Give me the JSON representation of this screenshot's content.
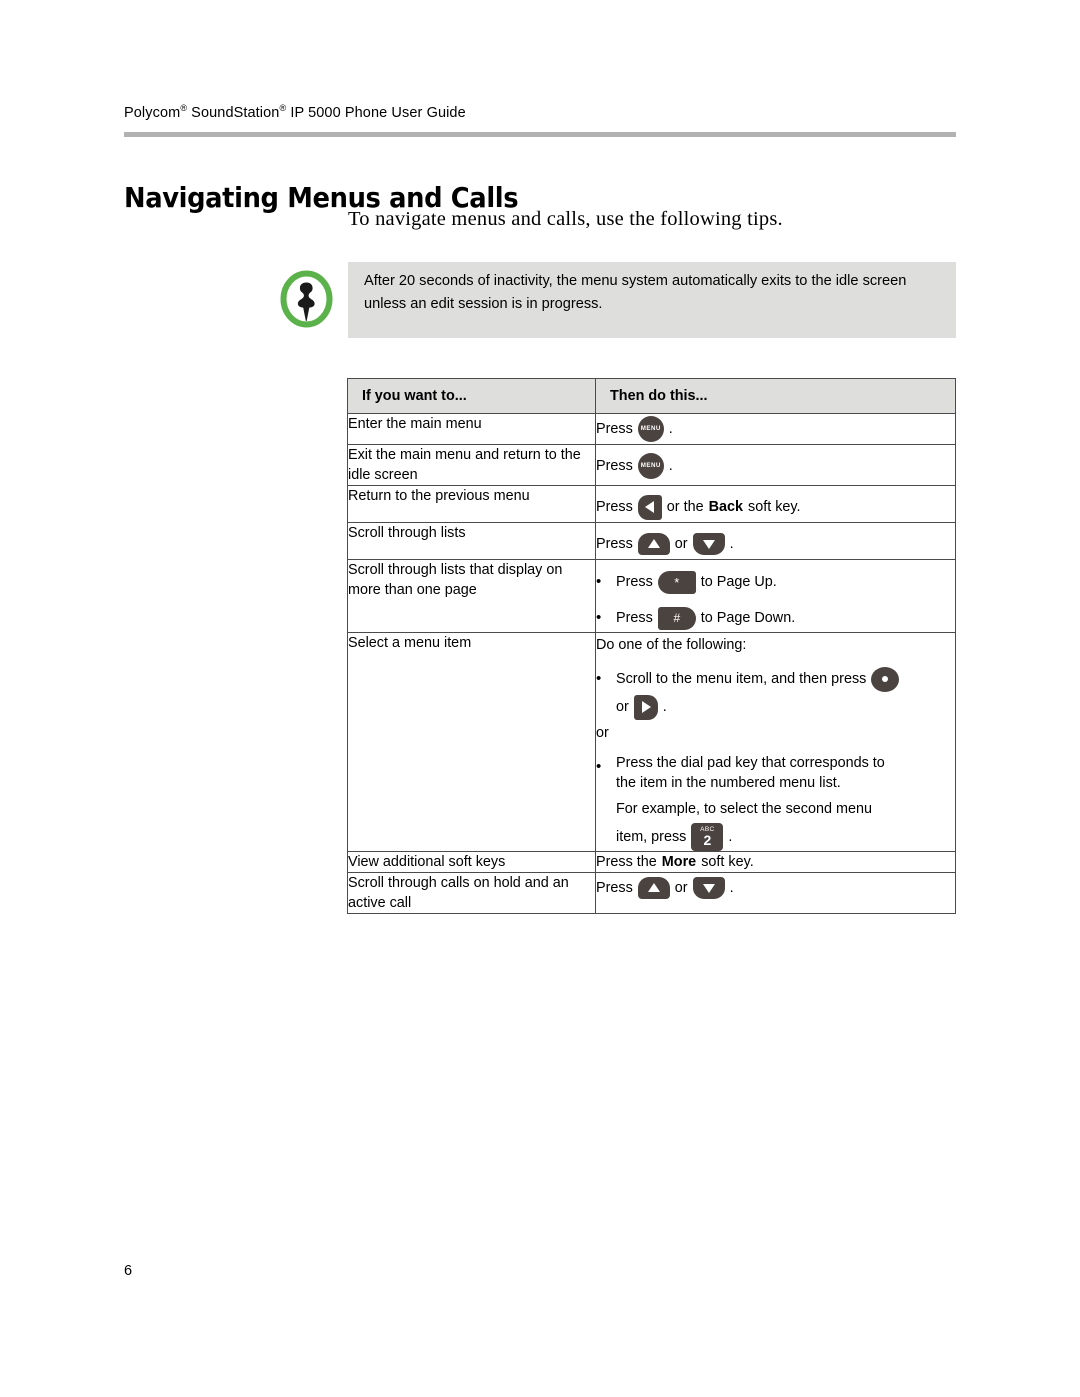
{
  "header": {
    "running_head_part1": "Polycom",
    "running_head_sup1": "®",
    "running_head_part2": " SoundStation",
    "running_head_sup2": "®",
    "running_head_part3": " IP 5000 Phone User Guide"
  },
  "title": "Navigating Menus and Calls",
  "intro": "To navigate menus and calls, use the following tips.",
  "note": {
    "icon": "note-pushpin-icon",
    "ring_color": "#5cb24a",
    "background": "#dededd",
    "text": "After 20 seconds of inactivity, the menu system automatically exits to the idle screen unless an edit session is in progress."
  },
  "table": {
    "headers": {
      "col1": "If you want to...",
      "col2": "Then do this..."
    },
    "rows": [
      {
        "task": "Enter the main menu",
        "press_label": "Press",
        "key": "MENU",
        "period": "."
      },
      {
        "task": "Exit the main menu and return to the idle screen",
        "press_label": "Press",
        "key": "MENU",
        "period": "."
      },
      {
        "task": "Return to the previous menu",
        "press_label": "Press",
        "mid": "or the",
        "bold": "Back",
        "tail": "soft key."
      },
      {
        "task": "Scroll through lists",
        "press_label": "Press",
        "or_label": "or",
        "period": "."
      },
      {
        "task": "Scroll through lists that display on more than one page",
        "bullet1_press": "Press",
        "bullet1_tail": "to Page Up.",
        "bullet1_key": "*",
        "bullet2_press": "Press",
        "bullet2_tail": "to Page Down.",
        "bullet2_key": "#"
      },
      {
        "task": "Select a menu item",
        "lead": "Do one of the following:",
        "bullet1": "Scroll to the menu item, and then press",
        "or_inline": "or",
        "period": ".",
        "or_standalone": "or",
        "bullet2_line1": "Press the dial pad key that corresponds to",
        "bullet2_line2": "the item in the numbered menu list.",
        "bullet2_line3": "For example, to select the second menu",
        "bullet2_line4_pre": "item, press",
        "bullet2_line4_post": ".",
        "digit_key_letters": "ABC",
        "digit_key_number": "2"
      },
      {
        "task": "View additional soft keys",
        "pre": "Press the",
        "bold": "More",
        "post": "soft key."
      },
      {
        "task": "Scroll through calls on hold and an active call",
        "press_label": "Press",
        "or_label": "or",
        "period": "."
      }
    ]
  },
  "footer": {
    "page_number": "6"
  },
  "colors": {
    "key_dark": "#4a4340",
    "rule_gray": "#b2b2b2",
    "table_border": "#4b4b4b",
    "header_fill": "#dededd"
  }
}
